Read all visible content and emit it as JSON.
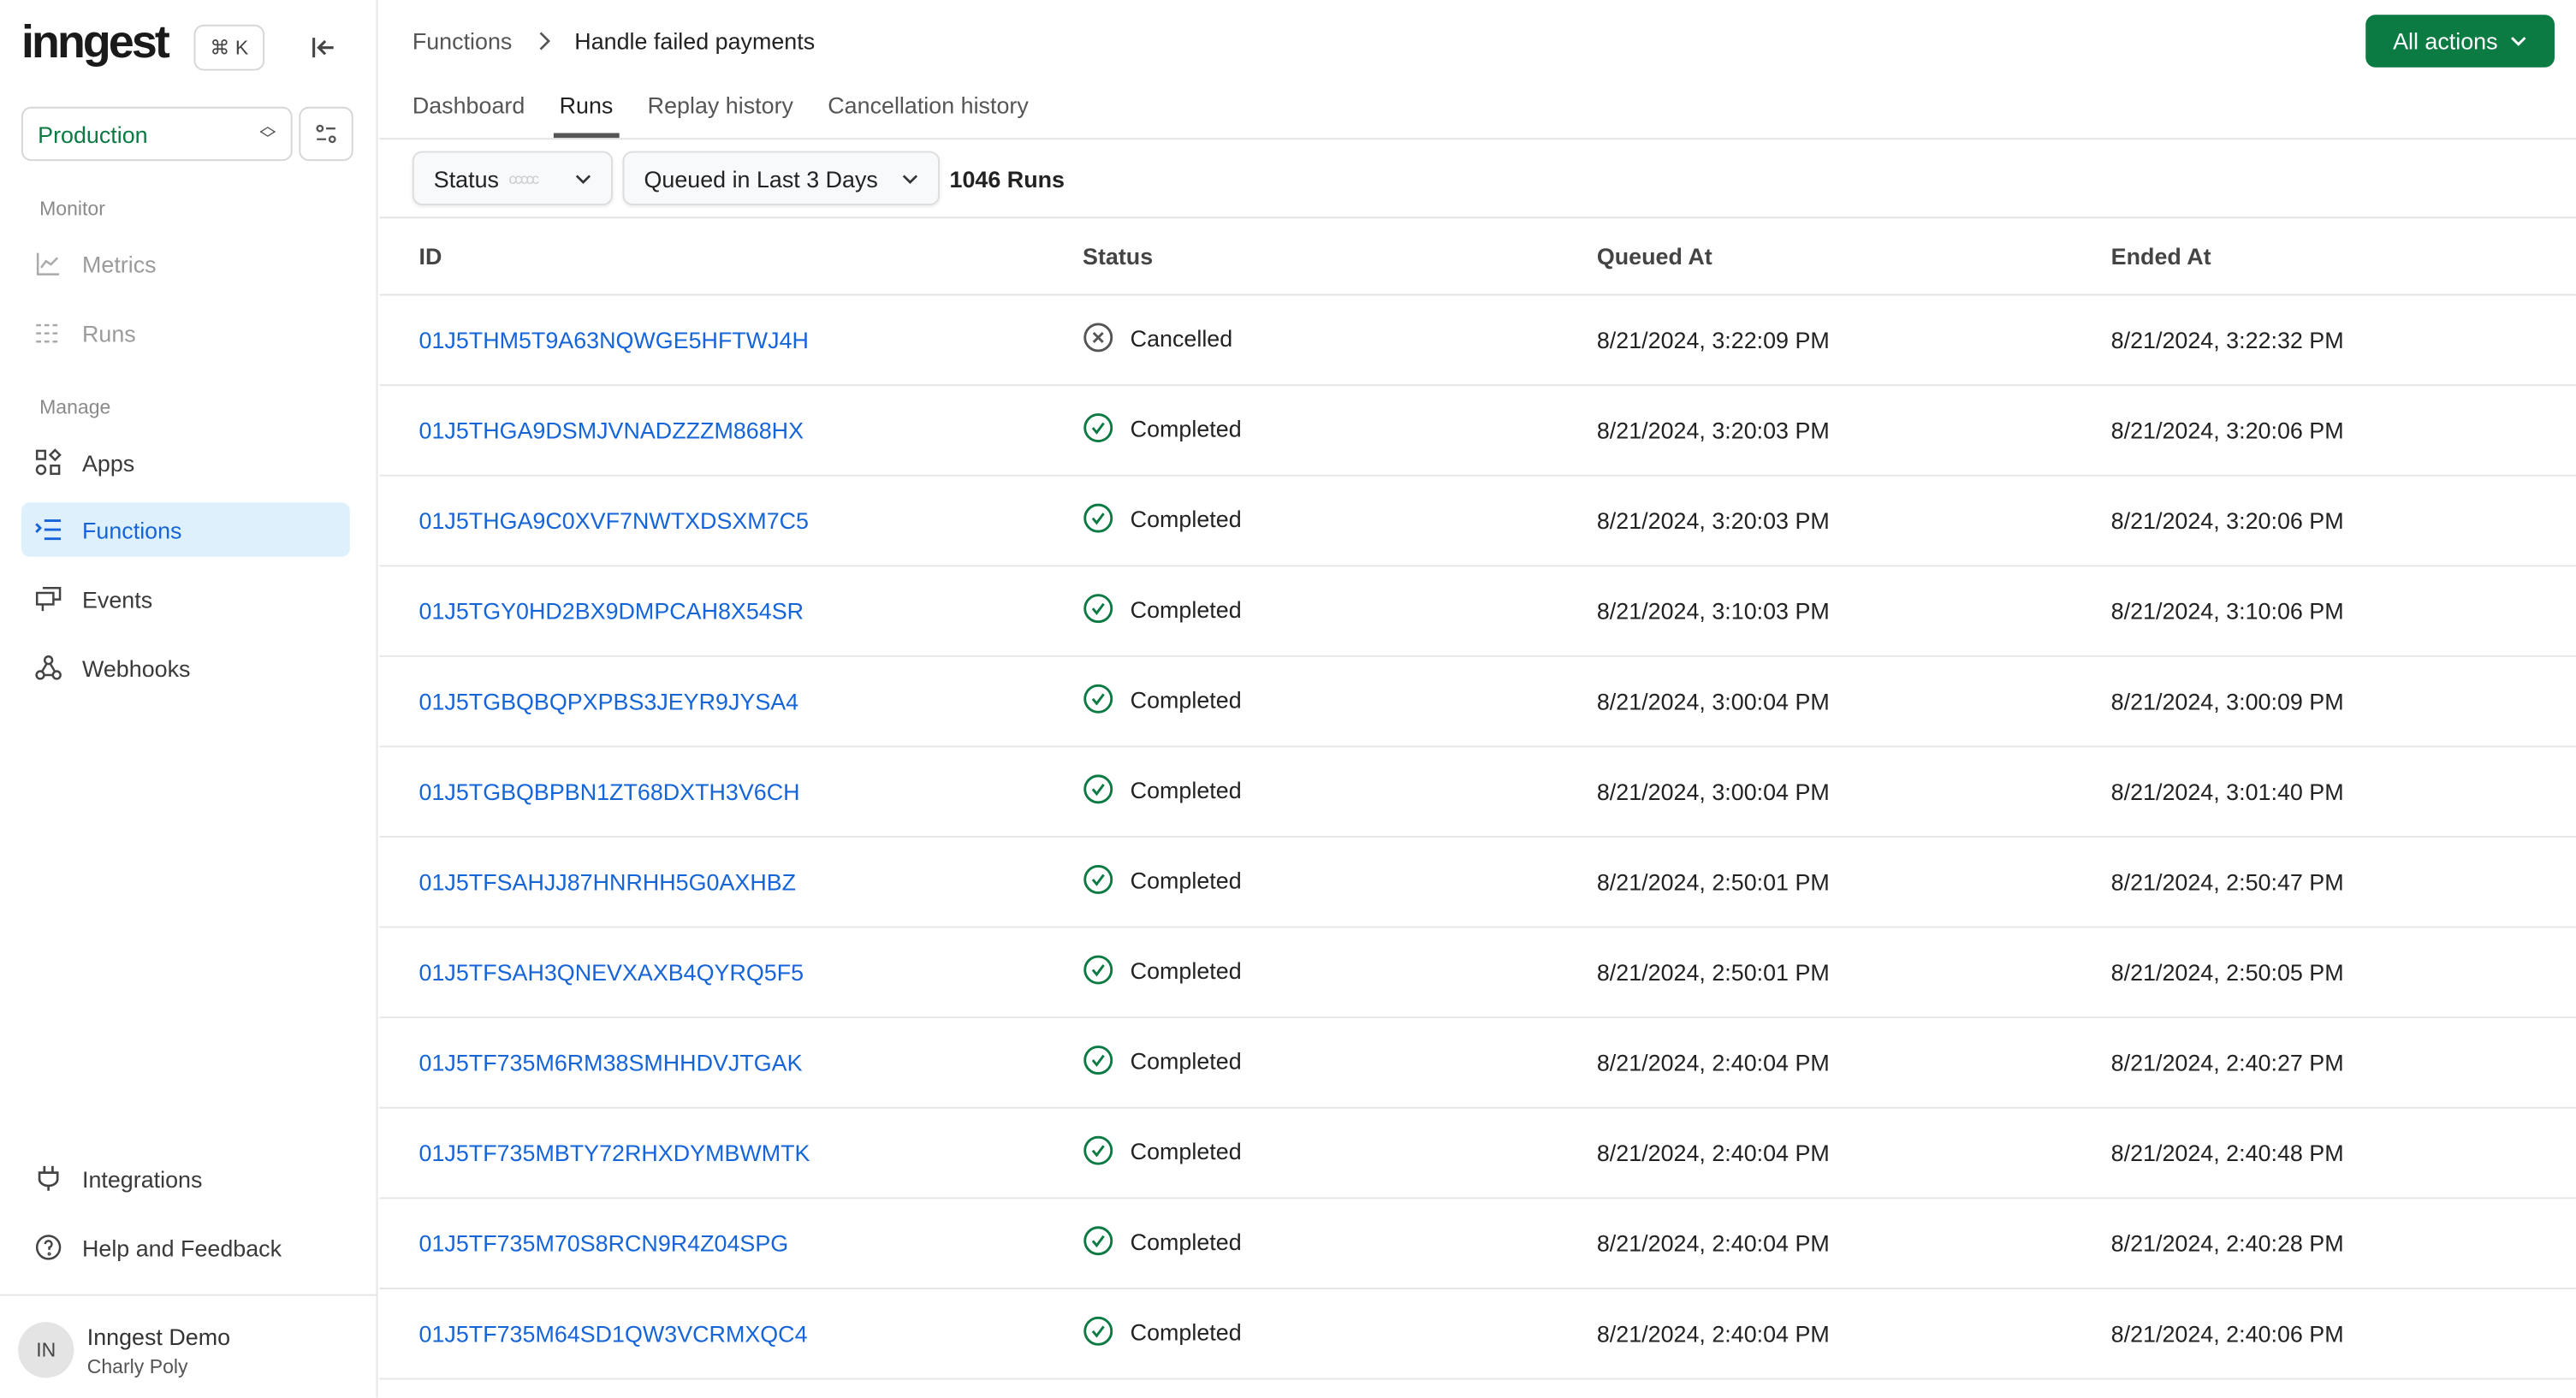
{
  "sidebar": {
    "logo": "inngest",
    "shortcut": "⌘ K",
    "environment": "Production",
    "sections": {
      "monitor": "Monitor",
      "manage": "Manage"
    },
    "items": [
      {
        "label": "Metrics"
      },
      {
        "label": "Runs"
      },
      {
        "label": "Apps"
      },
      {
        "label": "Functions"
      },
      {
        "label": "Events"
      },
      {
        "label": "Webhooks"
      },
      {
        "label": "Integrations"
      },
      {
        "label": "Help and Feedback"
      }
    ],
    "user": {
      "initials": "IN",
      "org": "Inngest Demo",
      "name": "Charly Poly"
    }
  },
  "header": {
    "breadcrumb": [
      "Functions",
      "Handle failed payments"
    ],
    "all_actions": "All actions"
  },
  "tabs": [
    {
      "label": "Dashboard"
    },
    {
      "label": "Runs",
      "active": true
    },
    {
      "label": "Replay history"
    },
    {
      "label": "Cancellation history"
    }
  ],
  "filters": {
    "status_label": "Status",
    "status_dots": "ccccc",
    "time_range": "Queued in Last 3 Days",
    "count": "1046 Runs"
  },
  "table": {
    "columns": [
      "ID",
      "Status",
      "Queued At",
      "Ended At"
    ],
    "rows": [
      {
        "id": "01J5THM5T9A63NQWGE5HFTWJ4H",
        "status": "Cancelled",
        "queued": "8/21/2024, 3:22:09 PM",
        "ended": "8/21/2024, 3:22:32 PM"
      },
      {
        "id": "01J5THGA9DSMJVNADZZZM868HX",
        "status": "Completed",
        "queued": "8/21/2024, 3:20:03 PM",
        "ended": "8/21/2024, 3:20:06 PM"
      },
      {
        "id": "01J5THGA9C0XVF7NWTXDSXM7C5",
        "status": "Completed",
        "queued": "8/21/2024, 3:20:03 PM",
        "ended": "8/21/2024, 3:20:06 PM"
      },
      {
        "id": "01J5TGY0HD2BX9DMPCAH8X54SR",
        "status": "Completed",
        "queued": "8/21/2024, 3:10:03 PM",
        "ended": "8/21/2024, 3:10:06 PM"
      },
      {
        "id": "01J5TGBQBQPXPBS3JEYR9JYSA4",
        "status": "Completed",
        "queued": "8/21/2024, 3:00:04 PM",
        "ended": "8/21/2024, 3:00:09 PM"
      },
      {
        "id": "01J5TGBQBPBN1ZT68DXTH3V6CH",
        "status": "Completed",
        "queued": "8/21/2024, 3:00:04 PM",
        "ended": "8/21/2024, 3:01:40 PM"
      },
      {
        "id": "01J5TFSAHJJ87HNRHH5G0AXHBZ",
        "status": "Completed",
        "queued": "8/21/2024, 2:50:01 PM",
        "ended": "8/21/2024, 2:50:47 PM"
      },
      {
        "id": "01J5TFSAH3QNEVXAXB4QYRQ5F5",
        "status": "Completed",
        "queued": "8/21/2024, 2:50:01 PM",
        "ended": "8/21/2024, 2:50:05 PM"
      },
      {
        "id": "01J5TF735M6RM38SMHHDVJTGAK",
        "status": "Completed",
        "queued": "8/21/2024, 2:40:04 PM",
        "ended": "8/21/2024, 2:40:27 PM"
      },
      {
        "id": "01J5TF735MBTY72RHXDYMBWMTK",
        "status": "Completed",
        "queued": "8/21/2024, 2:40:04 PM",
        "ended": "8/21/2024, 2:40:48 PM"
      },
      {
        "id": "01J5TF735M70S8RCN9R4Z04SPG",
        "status": "Completed",
        "queued": "8/21/2024, 2:40:04 PM",
        "ended": "8/21/2024, 2:40:28 PM"
      },
      {
        "id": "01J5TF735M64SD1QW3VCRMXQC4",
        "status": "Completed",
        "queued": "8/21/2024, 2:40:04 PM",
        "ended": "8/21/2024, 2:40:06 PM"
      }
    ]
  },
  "colors": {
    "accent": "#0c7a43",
    "link": "#1565d8",
    "active_bg": "#dff0fd",
    "completed": "#0c7a43",
    "cancelled": "#555555"
  }
}
